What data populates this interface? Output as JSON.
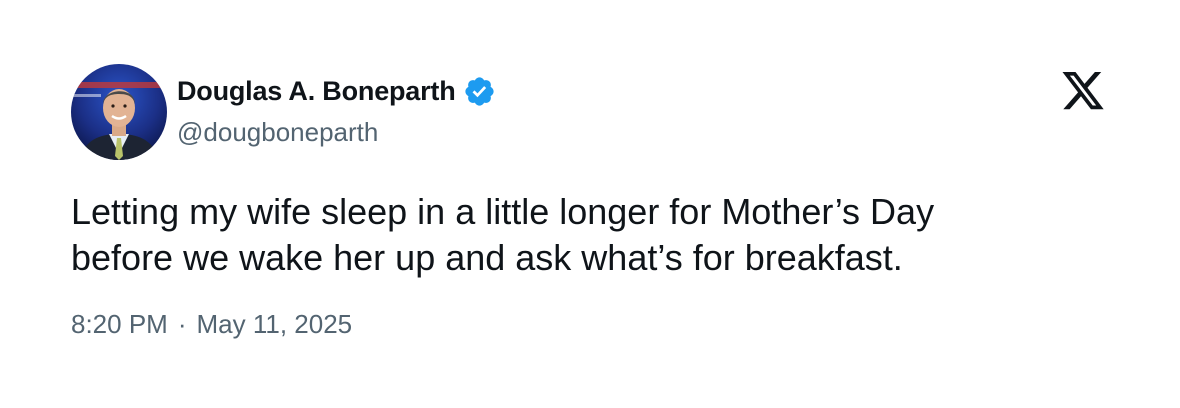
{
  "author": {
    "display_name": "Douglas A. Boneparth",
    "handle": "@dougboneparth",
    "verified": true,
    "verified_color": "#1d9bf0"
  },
  "tweet": {
    "text": "Letting my wife sleep in a little longer for Mother’s Day\nbefore we wake her up and ask what’s for breakfast.",
    "time": "8:20 PM",
    "separator": "·",
    "date": "May 11, 2025"
  },
  "icons": {
    "brand": "x-logo-icon",
    "badge": "verified-badge-icon"
  },
  "colors": {
    "text_primary": "#0f1419",
    "text_secondary": "#536471",
    "background": "#ffffff"
  }
}
